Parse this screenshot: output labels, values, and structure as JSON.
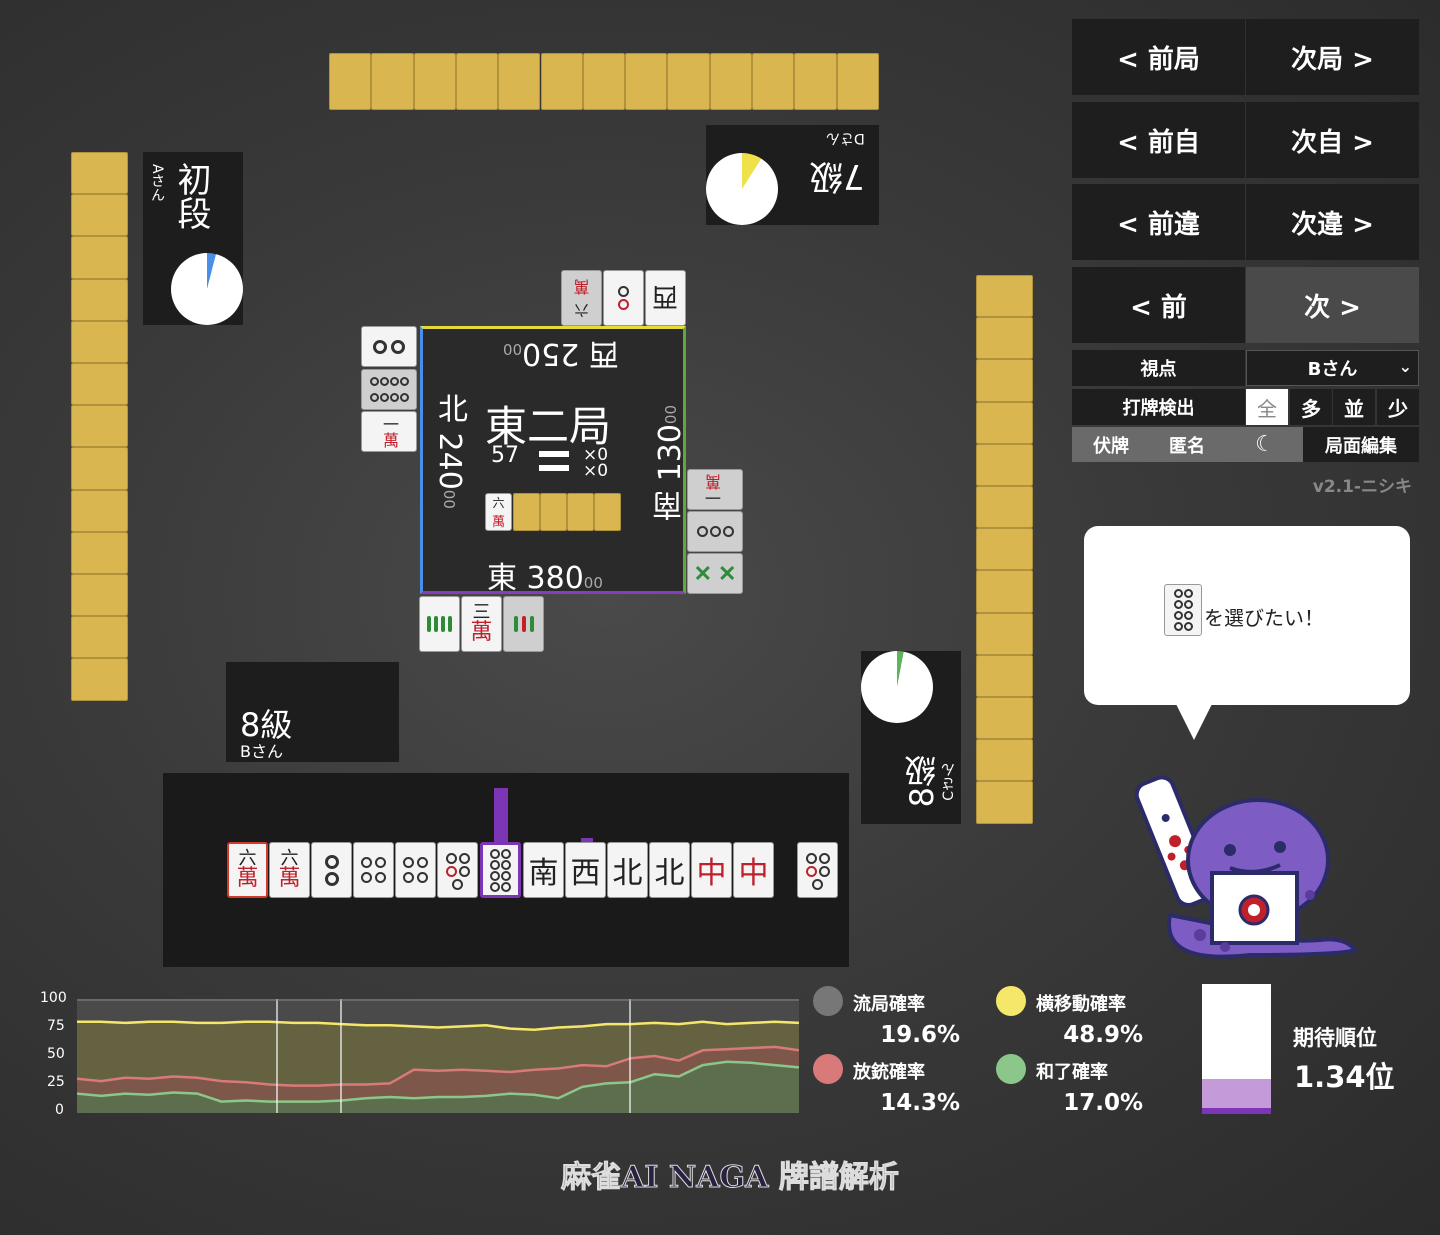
{
  "nav": {
    "prev_round": "< 前局",
    "next_round": "次局 >",
    "prev_self": "< 前自",
    "next_self": "次自 >",
    "prev_diff": "< 前違",
    "next_diff": "次違 >",
    "prev": "< 前",
    "next": "次 >"
  },
  "settings": {
    "viewpoint_label": "視点",
    "viewpoint_value": "Bさん",
    "discard_detect_label": "打牌検出",
    "detect_options": [
      "全",
      "多",
      "並",
      "少"
    ],
    "hidden_tiles": "伏牌",
    "anonymous": "匿名",
    "night_icon": "moon-icon",
    "edit_position": "局面編集",
    "version": "v2.1-ニシキ"
  },
  "speech": {
    "text": "を選びたい！"
  },
  "players": {
    "top": {
      "rank": "7級",
      "name": "Dさん"
    },
    "left": {
      "rank": "初段",
      "name": "Aさん"
    },
    "bottom": {
      "rank": "8級",
      "name": "Bさん"
    },
    "right": {
      "rank": "8級",
      "name": "Cさん"
    }
  },
  "center": {
    "round": "東二局",
    "tiles_left": "57",
    "honba": "×0",
    "riichi": "×0",
    "west_score": "西 250",
    "west_sub": "00",
    "north_score": "北 240",
    "north_sub": "00",
    "south_score": "南 130",
    "south_sub": "00",
    "east_score": "東 380",
    "east_sub": "00",
    "dora_num": "六",
    "dora_suf": "萬"
  },
  "hand": {
    "honors": [
      "南",
      "西",
      "北",
      "北",
      "中",
      "中"
    ],
    "man_num": "六",
    "man_suf": "萬",
    "man_num2": "二",
    "man_num3": "三",
    "man_num4": "一"
  },
  "chart": {
    "yticks": [
      "100",
      "75",
      "50",
      "25",
      "0"
    ]
  },
  "chart_data": {
    "type": "area",
    "ylim": [
      0,
      100
    ],
    "series": [
      {
        "name": "横移動確率",
        "color": "#f5e76a",
        "values": [
          80,
          80,
          79,
          80,
          80,
          79,
          79,
          80,
          80,
          79,
          79,
          78,
          77,
          77,
          76,
          75,
          76,
          77,
          74,
          73,
          75,
          76,
          78,
          78,
          79,
          78,
          80,
          78,
          79,
          80,
          79
        ]
      },
      {
        "name": "放銃確率",
        "color": "#d97a7a",
        "values": [
          30,
          28,
          31,
          30,
          32,
          31,
          28,
          27,
          25,
          24,
          24,
          25,
          25,
          26,
          38,
          37,
          38,
          37,
          36,
          38,
          39,
          42,
          41,
          48,
          50,
          46,
          55,
          56,
          57,
          58,
          55
        ]
      },
      {
        "name": "和了確率",
        "color": "#8bc78a",
        "values": [
          17,
          15,
          17,
          16,
          18,
          17,
          10,
          11,
          10,
          10,
          10,
          11,
          13,
          14,
          13,
          14,
          14,
          15,
          17,
          16,
          13,
          23,
          26,
          27,
          34,
          32,
          42,
          45,
          44,
          42,
          40
        ]
      }
    ]
  },
  "stats": {
    "ryukyoku_label": "流局確率",
    "ryukyoku_value": "19.6%",
    "yoko_label": "横移動確率",
    "yoko_value": "48.9%",
    "houju_label": "放銃確率",
    "houju_value": "14.3%",
    "agari_label": "和了確率",
    "agari_value": "17.0%",
    "expected_label": "期待順位",
    "expected_value": "1.34位",
    "expected_rank": 1.34,
    "colors": {
      "ryukyoku": "#777777",
      "yoko": "#f5e76a",
      "houju": "#d97a7a",
      "agari": "#8bc78a"
    }
  },
  "logo": "麻雀AI NAGA 牌譜解析"
}
